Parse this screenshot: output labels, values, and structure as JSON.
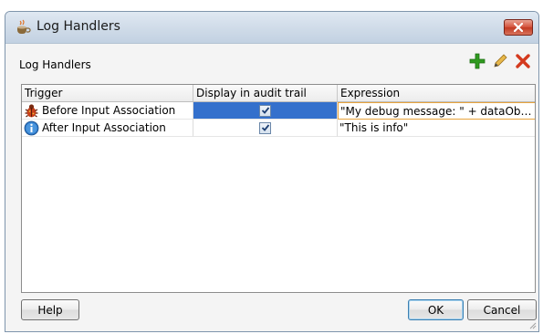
{
  "window": {
    "title": "Log Handlers",
    "icon": "coffee-cup-icon"
  },
  "section": {
    "label": "Log Handlers"
  },
  "toolbar": {
    "add_icon": "add-icon",
    "edit_icon": "edit-pencil-icon",
    "delete_icon": "delete-icon",
    "colors": {
      "add": "#2f9a1f",
      "edit": "#d6a12a",
      "delete": "#d43a1e"
    }
  },
  "table": {
    "columns": [
      "Trigger",
      "Display in audit trail",
      "Expression"
    ],
    "rows": [
      {
        "trigger": "Before Input Association",
        "icon": "bug-icon",
        "display_in_audit_trail": true,
        "expression": "\"My debug message: \" + dataObje...",
        "selected": true
      },
      {
        "trigger": "After Input Association",
        "icon": "info-icon",
        "display_in_audit_trail": true,
        "expression": "\"This is info\"",
        "selected": false
      }
    ]
  },
  "buttons": {
    "help": "Help",
    "ok": "OK",
    "cancel": "Cancel"
  },
  "colors": {
    "selection": "#3470cc",
    "edit_border": "#e9a43c"
  }
}
